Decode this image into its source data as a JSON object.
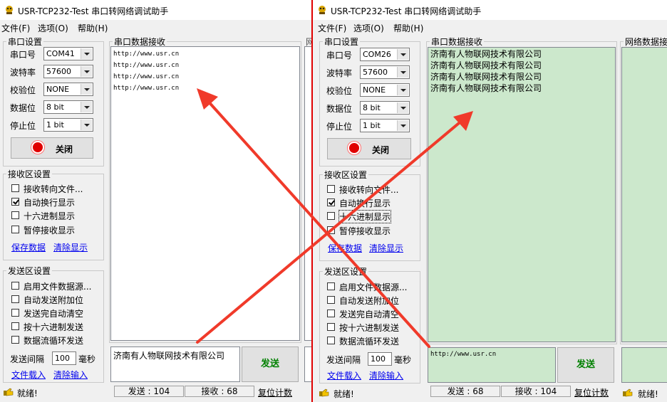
{
  "left": {
    "title": "USR-TCP232-Test 串口转网络调试助手",
    "menu": [
      "文件(F)",
      "选项(O)",
      "帮助(H)"
    ],
    "serial_group": "串口设置",
    "fields": [
      {
        "label": "串口号",
        "value": "COM41"
      },
      {
        "label": "波特率",
        "value": "57600"
      },
      {
        "label": "校验位",
        "value": "NONE"
      },
      {
        "label": "数据位",
        "value": "8 bit"
      },
      {
        "label": "停止位",
        "value": "1 bit"
      }
    ],
    "close_label": "关闭",
    "recv_settings_group": "接收区设置",
    "recv_options": [
      {
        "label": "接收转向文件...",
        "checked": false
      },
      {
        "label": "自动换行显示",
        "checked": true
      },
      {
        "label": "十六进制显示",
        "checked": false
      },
      {
        "label": "暂停接收显示",
        "checked": false
      }
    ],
    "save_data": "保存数据",
    "clear_display": "清除显示",
    "send_settings_group": "发送区设置",
    "send_options": [
      {
        "label": "启用文件数据源...",
        "checked": false
      },
      {
        "label": "自动发送附加位",
        "checked": false
      },
      {
        "label": "发送完自动清空",
        "checked": false
      },
      {
        "label": "按十六进制发送",
        "checked": false
      },
      {
        "label": "数据流循环发送",
        "checked": false
      }
    ],
    "interval_label": "发送间隔",
    "interval_value": "100",
    "interval_unit": "毫秒",
    "load_file": "文件载入",
    "clear_input": "清除输入",
    "recv_group": "串口数据接收",
    "recv_lines": [
      "http://www.usr.cn",
      "http://www.usr.cn",
      "http://www.usr.cn",
      "http://www.usr.cn"
    ],
    "send_text": "济南有人物联网技术有限公司",
    "send_button": "发送",
    "net_group_fragment": "网",
    "status_ready": "就绪!",
    "status_sent": "发送 : 104",
    "status_recv": "接收 : 68",
    "status_reset": "复位计数"
  },
  "right": {
    "title": "USR-TCP232-Test 串口转网络调试助手",
    "menu": [
      "文件(F)",
      "选项(O)",
      "帮助(H)"
    ],
    "serial_group": "串口设置",
    "fields": [
      {
        "label": "串口号",
        "value": "COM26"
      },
      {
        "label": "波特率",
        "value": "57600"
      },
      {
        "label": "校验位",
        "value": "NONE"
      },
      {
        "label": "数据位",
        "value": "8 bit"
      },
      {
        "label": "停止位",
        "value": "1 bit"
      }
    ],
    "close_label": "关闭",
    "recv_settings_group": "接收区设置",
    "recv_options": [
      {
        "label": "接收转向文件...",
        "checked": false
      },
      {
        "label": "自动换行显示",
        "checked": true
      },
      {
        "label": "十六进制显示",
        "checked": false
      },
      {
        "label": "暂停接收显示",
        "checked": false
      }
    ],
    "save_data": "保存数据",
    "clear_display": "清除显示",
    "send_settings_group": "发送区设置",
    "send_options": [
      {
        "label": "启用文件数据源...",
        "checked": false
      },
      {
        "label": "自动发送附加位",
        "checked": false
      },
      {
        "label": "发送完自动清空",
        "checked": false
      },
      {
        "label": "按十六进制发送",
        "checked": false
      },
      {
        "label": "数据流循环发送",
        "checked": false
      }
    ],
    "interval_label": "发送间隔",
    "interval_value": "100",
    "interval_unit": "毫秒",
    "load_file": "文件载入",
    "clear_input": "清除输入",
    "recv_group": "串口数据接收",
    "recv_lines": [
      "济南有人物联网技术有限公司",
      "济南有人物联网技术有限公司",
      "济南有人物联网技术有限公司",
      "济南有人物联网技术有限公司"
    ],
    "send_text": "http://www.usr.cn",
    "send_button": "发送",
    "net_group": "网络数据接",
    "status_ready": "就绪!",
    "status_sent": "发送 : 68",
    "status_recv": "接收 : 104",
    "status_reset": "复位计数",
    "status_ready_2": "就绪!"
  },
  "colors": {
    "recv_green": "#cce8cc",
    "annotation_red": "#f03a2a",
    "send_green_text": "#008000",
    "link_blue": "#0000ee"
  }
}
